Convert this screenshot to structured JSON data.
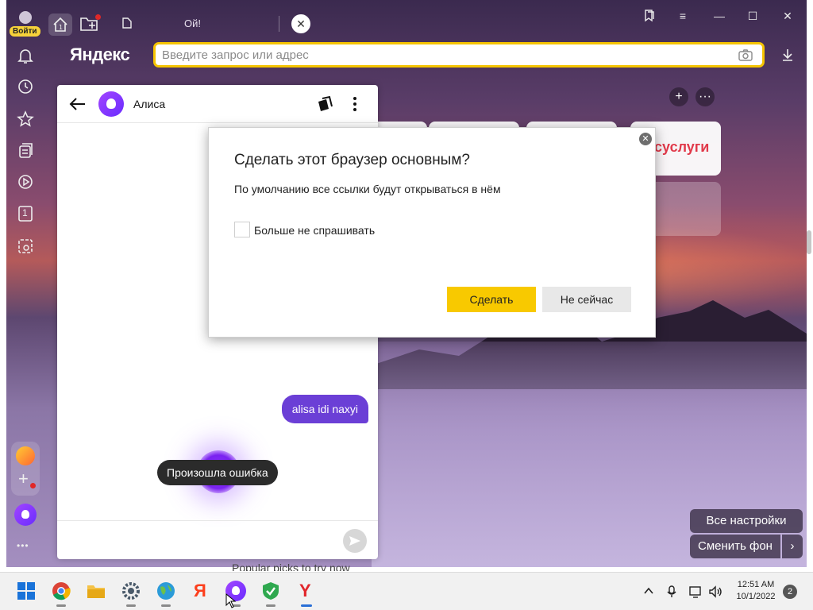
{
  "browser": {
    "logo": "Яндекс",
    "login_label": "Войти",
    "tab_home_badge": "1",
    "tab_title": "Ой!",
    "address_placeholder": "Введите запрос или адрес",
    "sidebar_tab_counter": "1",
    "sidebar_more": "•••"
  },
  "window_controls": {
    "bookmarks": "bookmarks-panel",
    "menu": "≡",
    "minimize": "—",
    "maximize": "☐",
    "close": "✕"
  },
  "alice": {
    "name": "Алиса",
    "user_message": "alisa idi naxyi",
    "error_toast": "Произошла ошибка"
  },
  "newtab": {
    "tile_gosuslugi": "суслуги",
    "add_button": "+",
    "more_button": "···",
    "all_settings": "Все настройки",
    "change_background": "Сменить фон",
    "change_background_arrow": "›",
    "behind_text": "Popular picks to try now"
  },
  "dialog": {
    "title": "Сделать этот браузер основным?",
    "text": "По умолчанию все ссылки будут открываться в нём",
    "checkbox_label": "Больше не спрашивать",
    "confirm": "Сделать",
    "cancel": "Не сейчас",
    "close": "✕"
  },
  "taskbar": {
    "time": "12:51 AM",
    "date": "10/1/2022",
    "notifications": "2",
    "yandex_letter": "Я",
    "yandex_browser_letter": "Y"
  },
  "colors": {
    "accent_yellow": "#f8c900",
    "alice_purple": "#6b3fd6",
    "gosuslugi_red": "#e1394a"
  }
}
